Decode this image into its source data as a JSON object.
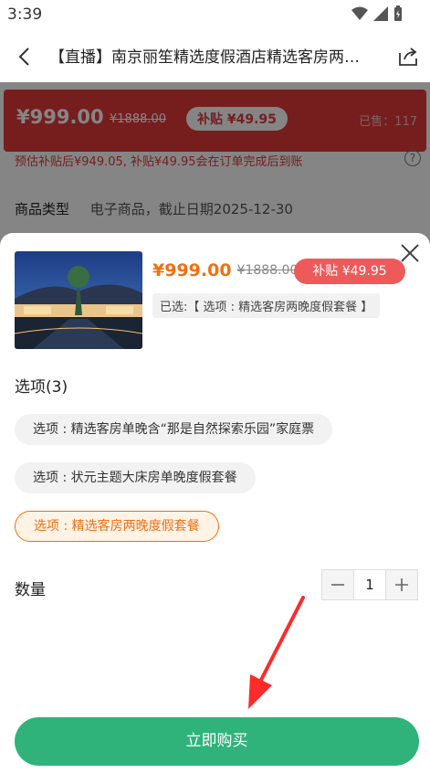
{
  "status_bar": {
    "time": "3:39"
  },
  "nav": {
    "title": "【直播】南京丽笙精选度假酒店精选客房两…"
  },
  "background": {
    "banner_price": "¥999.00",
    "banner_orig_price": "¥1888.00",
    "banner_subsidy": "补贴 ¥49.95",
    "banner_sold": "已售：117",
    "estimate_text": "预估补贴后¥949.05, 补贴¥49.95会在订单完成后到账",
    "goods_type_label": "商品类型",
    "goods_type_value": "电子商品，截止日期2025-12-30"
  },
  "sheet": {
    "price": "¥999.00",
    "orig_price": "¥1888.00",
    "subsidy": "补贴 ¥49.95",
    "selected": "已选:【 选项 : 精选客房两晚度假套餐 】",
    "options_heading": "选项(3)",
    "options": [
      {
        "label": "选项 : 精选客房单晚含“那是自然探索乐园”家庭票",
        "selected": false
      },
      {
        "label": "选项 : 状元主题大床房单晚度假套餐",
        "selected": false
      },
      {
        "label": "选项 : 精选客房两晚度假套餐",
        "selected": true
      }
    ],
    "quantity_label": "数量",
    "quantity_value": "1",
    "buy_label": "立即购买"
  },
  "colors": {
    "accent": "#f07012",
    "subsidy": "#ee5a5a",
    "buy": "#2fb37a"
  }
}
